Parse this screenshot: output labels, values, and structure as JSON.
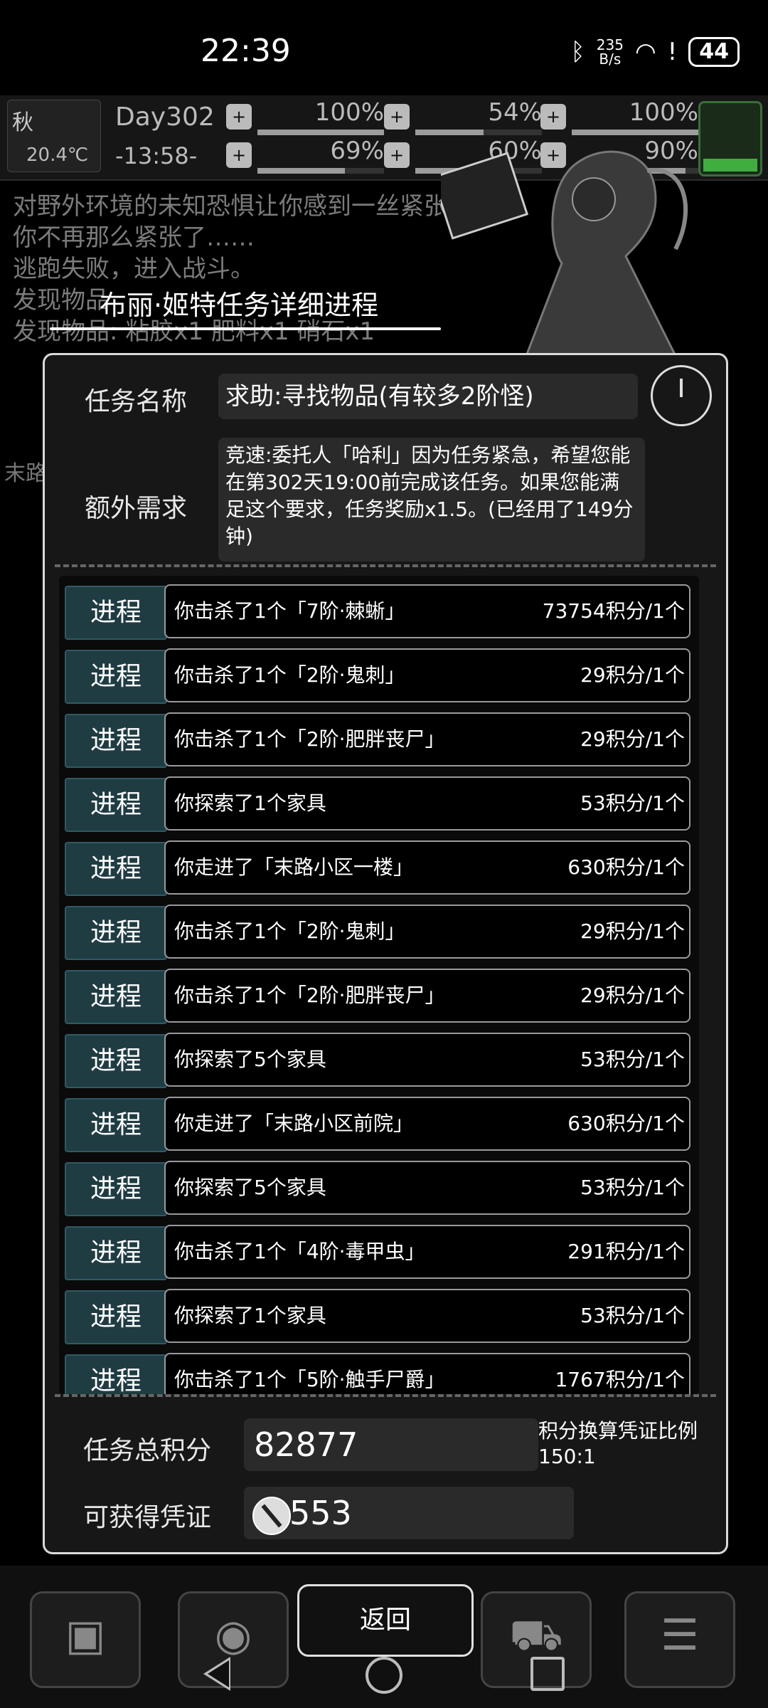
{
  "status_bar": {
    "time": "22:39",
    "net_speed_value": "235",
    "net_speed_unit": "B/s",
    "battery": "44"
  },
  "hud": {
    "season": "秋",
    "temperature": "20.4℃",
    "day": "Day302",
    "clock": "-13:58-",
    "stats": [
      {
        "icon": "medkit-icon",
        "value": "100%",
        "level": 1.0
      },
      {
        "icon": "stomach-icon",
        "value": "54%",
        "level": 0.54
      },
      {
        "icon": "mood-icon",
        "value": "100%",
        "level": 1.0
      },
      {
        "icon": "leg-icon",
        "value": "69%",
        "level": 0.69
      },
      {
        "icon": "water-drop-icon",
        "value": "60%",
        "level": 0.6
      },
      {
        "icon": "heart-icon",
        "value": "90%",
        "level": 0.9
      }
    ],
    "battery_level": 0.2
  },
  "log": {
    "lines": [
      "对野外环境的未知恐惧让你感到一丝紧张……",
      "你不再那么紧张了……",
      "逃跑失败，进入战斗。",
      "发现物品",
      "发现物品:  粘胶x1  肥料x1  硝石x1"
    ],
    "side_tag": "末路"
  },
  "dialog": {
    "title": "布丽·姬特任务详细进程",
    "quest_name_label": "任务名称",
    "quest_name": "求助:寻找物品(有较多2阶怪)",
    "extra_label": "额外需求",
    "extra_text": "竞速:委托人「哈利」因为任务紧急，希望您能在第302天19:00前完成该任务。如果您能满足这个要求，任务奖励x1.5。(已经用了149分钟)",
    "progress_tag": "进程",
    "progress": [
      {
        "desc": "你击杀了1个「7阶·棘蜥」",
        "score": "73754积分/1个"
      },
      {
        "desc": "你击杀了1个「2阶·鬼刺」",
        "score": "29积分/1个"
      },
      {
        "desc": "你击杀了1个「2阶·肥胖丧尸」",
        "score": "29积分/1个"
      },
      {
        "desc": "你探索了1个家具",
        "score": "53积分/1个"
      },
      {
        "desc": "你走进了「末路小区一楼」",
        "score": "630积分/1个"
      },
      {
        "desc": "你击杀了1个「2阶·鬼刺」",
        "score": "29积分/1个"
      },
      {
        "desc": "你击杀了1个「2阶·肥胖丧尸」",
        "score": "29积分/1个"
      },
      {
        "desc": "你探索了5个家具",
        "score": "53积分/1个"
      },
      {
        "desc": "你走进了「末路小区前院」",
        "score": "630积分/1个"
      },
      {
        "desc": "你探索了5个家具",
        "score": "53积分/1个"
      },
      {
        "desc": "你击杀了1个「4阶·毒甲虫」",
        "score": "291积分/1个"
      },
      {
        "desc": "你探索了1个家具",
        "score": "53积分/1个"
      },
      {
        "desc": "你击杀了1个「5阶·触手尸爵」",
        "score": "1767积分/1个"
      }
    ],
    "total_label": "任务总积分",
    "total_value": "82877",
    "ratio_label": "积分换算凭证比例",
    "ratio_value": "150:1",
    "voucher_label": "可获得凭证",
    "voucher_value": "553"
  },
  "bottom": {
    "back_label": "返回",
    "buttons": [
      "backpack-icon",
      "brain-icon",
      "cart-icon",
      "menu-list-icon"
    ]
  }
}
